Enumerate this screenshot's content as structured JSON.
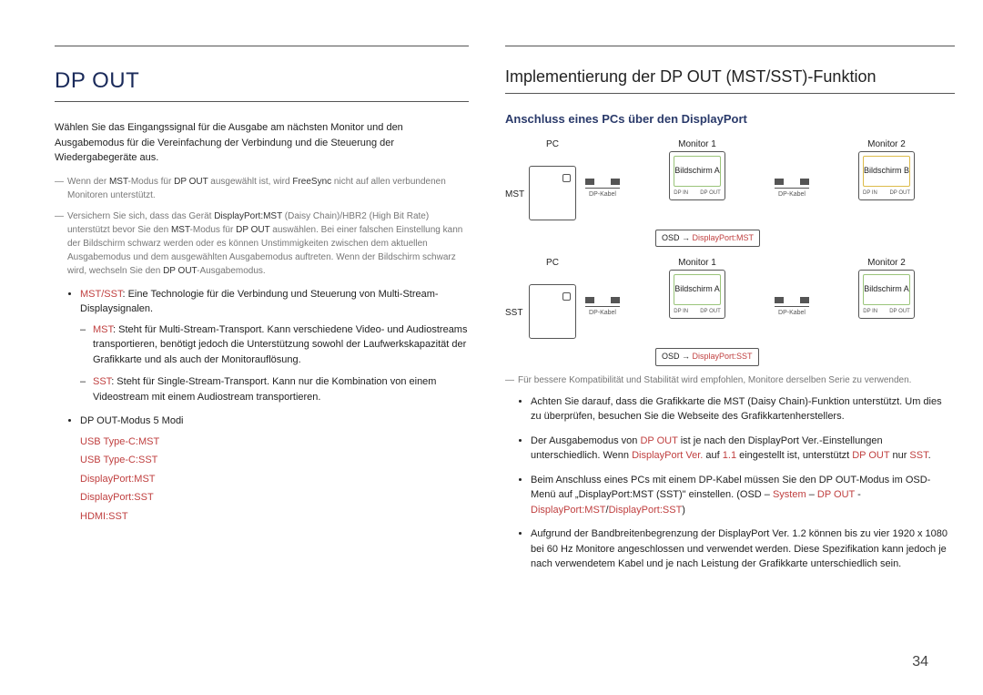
{
  "page_number": "34",
  "left": {
    "h1": "DP OUT",
    "intro": "Wählen Sie das Eingangssignal für die Ausgabe am nächsten Monitor und den Ausgabemodus für die Vereinfachung der Verbindung und die Steuerung der Wiedergabegeräte aus.",
    "note1_a": "Wenn der ",
    "note1_b": "MST",
    "note1_c": "-Modus für ",
    "note1_d": "DP OUT",
    "note1_e": " ausgewählt ist, wird ",
    "note1_f": "FreeSync",
    "note1_g": " nicht auf allen verbundenen Monitoren unterstützt.",
    "note2_a": "Versichern Sie sich, dass das Gerät ",
    "note2_b": "DisplayPort:MST",
    "note2_c": " (Daisy Chain)/HBR2 (High Bit Rate) unterstützt bevor Sie den ",
    "note2_d": "MST",
    "note2_e": "-Modus für ",
    "note2_f": "DP OUT",
    "note2_g": " auswählen. Bei einer falschen Einstellung kann der Bildschirm schwarz werden oder es können Unstimmigkeiten zwischen dem aktuellen Ausgabemodus und dem ausgewählten Ausgabemodus auftreten. Wenn der Bildschirm schwarz wird, wechseln Sie den ",
    "note2_h": "DP OUT",
    "note2_i": "-Ausgabemodus.",
    "bullet1_a": "MST/SST",
    "bullet1_b": ": Eine Technologie für die Verbindung und Steuerung von Multi-Stream-Displaysignalen.",
    "sub1_a": "MST",
    "sub1_b": ": Steht für Multi-Stream-Transport. Kann verschiedene Video- und Audiostreams transportieren, benötigt jedoch die Unterstützung sowohl der Laufwerkskapazität der Grafikkarte und als auch der Monitorauflösung.",
    "sub2_a": "SST",
    "sub2_b": ": Steht für Single-Stream-Transport. Kann nur die Kombination von einem Videostream mit einem Audiostream transportieren.",
    "bullet2": "DP OUT-Modus 5 Modi",
    "modes": [
      "USB Type-C:MST",
      "USB Type-C:SST",
      "DisplayPort:MST",
      "DisplayPort:SST",
      "HDMI:SST"
    ]
  },
  "right": {
    "h2": "Implementierung der DP OUT (MST/SST)-Funktion",
    "h3": "Anschluss eines PCs über den DisplayPort",
    "labels": {
      "pc": "PC",
      "mon1": "Monitor 1",
      "mon2": "Monitor 2",
      "mst": "MST",
      "sst": "SST",
      "screenA": "Bildschirm A",
      "screenB": "Bildschirm B",
      "cable": "DP-Kabel",
      "dpin": "DP IN",
      "dpout": "DP OUT",
      "osd_prefix": "OSD → ",
      "osd_mst": "DisplayPort:MST",
      "osd_sst": "DisplayPort:SST"
    },
    "note3": "Für bessere Kompatibilität und Stabilität wird empfohlen, Monitore derselben Serie zu verwenden.",
    "b1": "Achten Sie darauf, dass die Grafikkarte die MST (Daisy Chain)-Funktion unterstützt. Um dies zu überprüfen, besuchen Sie die Webseite des Grafikkartenherstellers.",
    "b2_a": "Der Ausgabemodus von ",
    "b2_b": "DP OUT",
    "b2_c": " ist je nach den DisplayPort Ver.-Einstellungen unterschiedlich. Wenn ",
    "b2_d": "DisplayPort Ver.",
    "b2_e": " auf ",
    "b2_f": "1.1",
    "b2_g": " eingestellt ist, unterstützt ",
    "b2_h": "DP OUT",
    "b2_i": " nur ",
    "b2_j": "SST",
    "b2_k": ".",
    "b3_a": "Beim Anschluss eines PCs mit einem DP-Kabel müssen Sie den DP OUT-Modus im OSD-Menü auf „DisplayPort:MST (SST)\" einstellen. (OSD – ",
    "b3_b": "System",
    "b3_c": " – ",
    "b3_d": "DP OUT",
    "b3_e": " - ",
    "b3_f": "DisplayPort:MST",
    "b3_g": "/",
    "b3_h": "DisplayPort:SST",
    "b3_i": ")",
    "b4": "Aufgrund der Bandbreitenbegrenzung der DisplayPort Ver. 1.2 können bis zu vier 1920 x 1080 bei 60 Hz Monitore angeschlossen und verwendet werden. Diese Spezifikation kann jedoch je nach verwendetem Kabel und je nach Leistung der Grafikkarte unterschiedlich sein."
  }
}
